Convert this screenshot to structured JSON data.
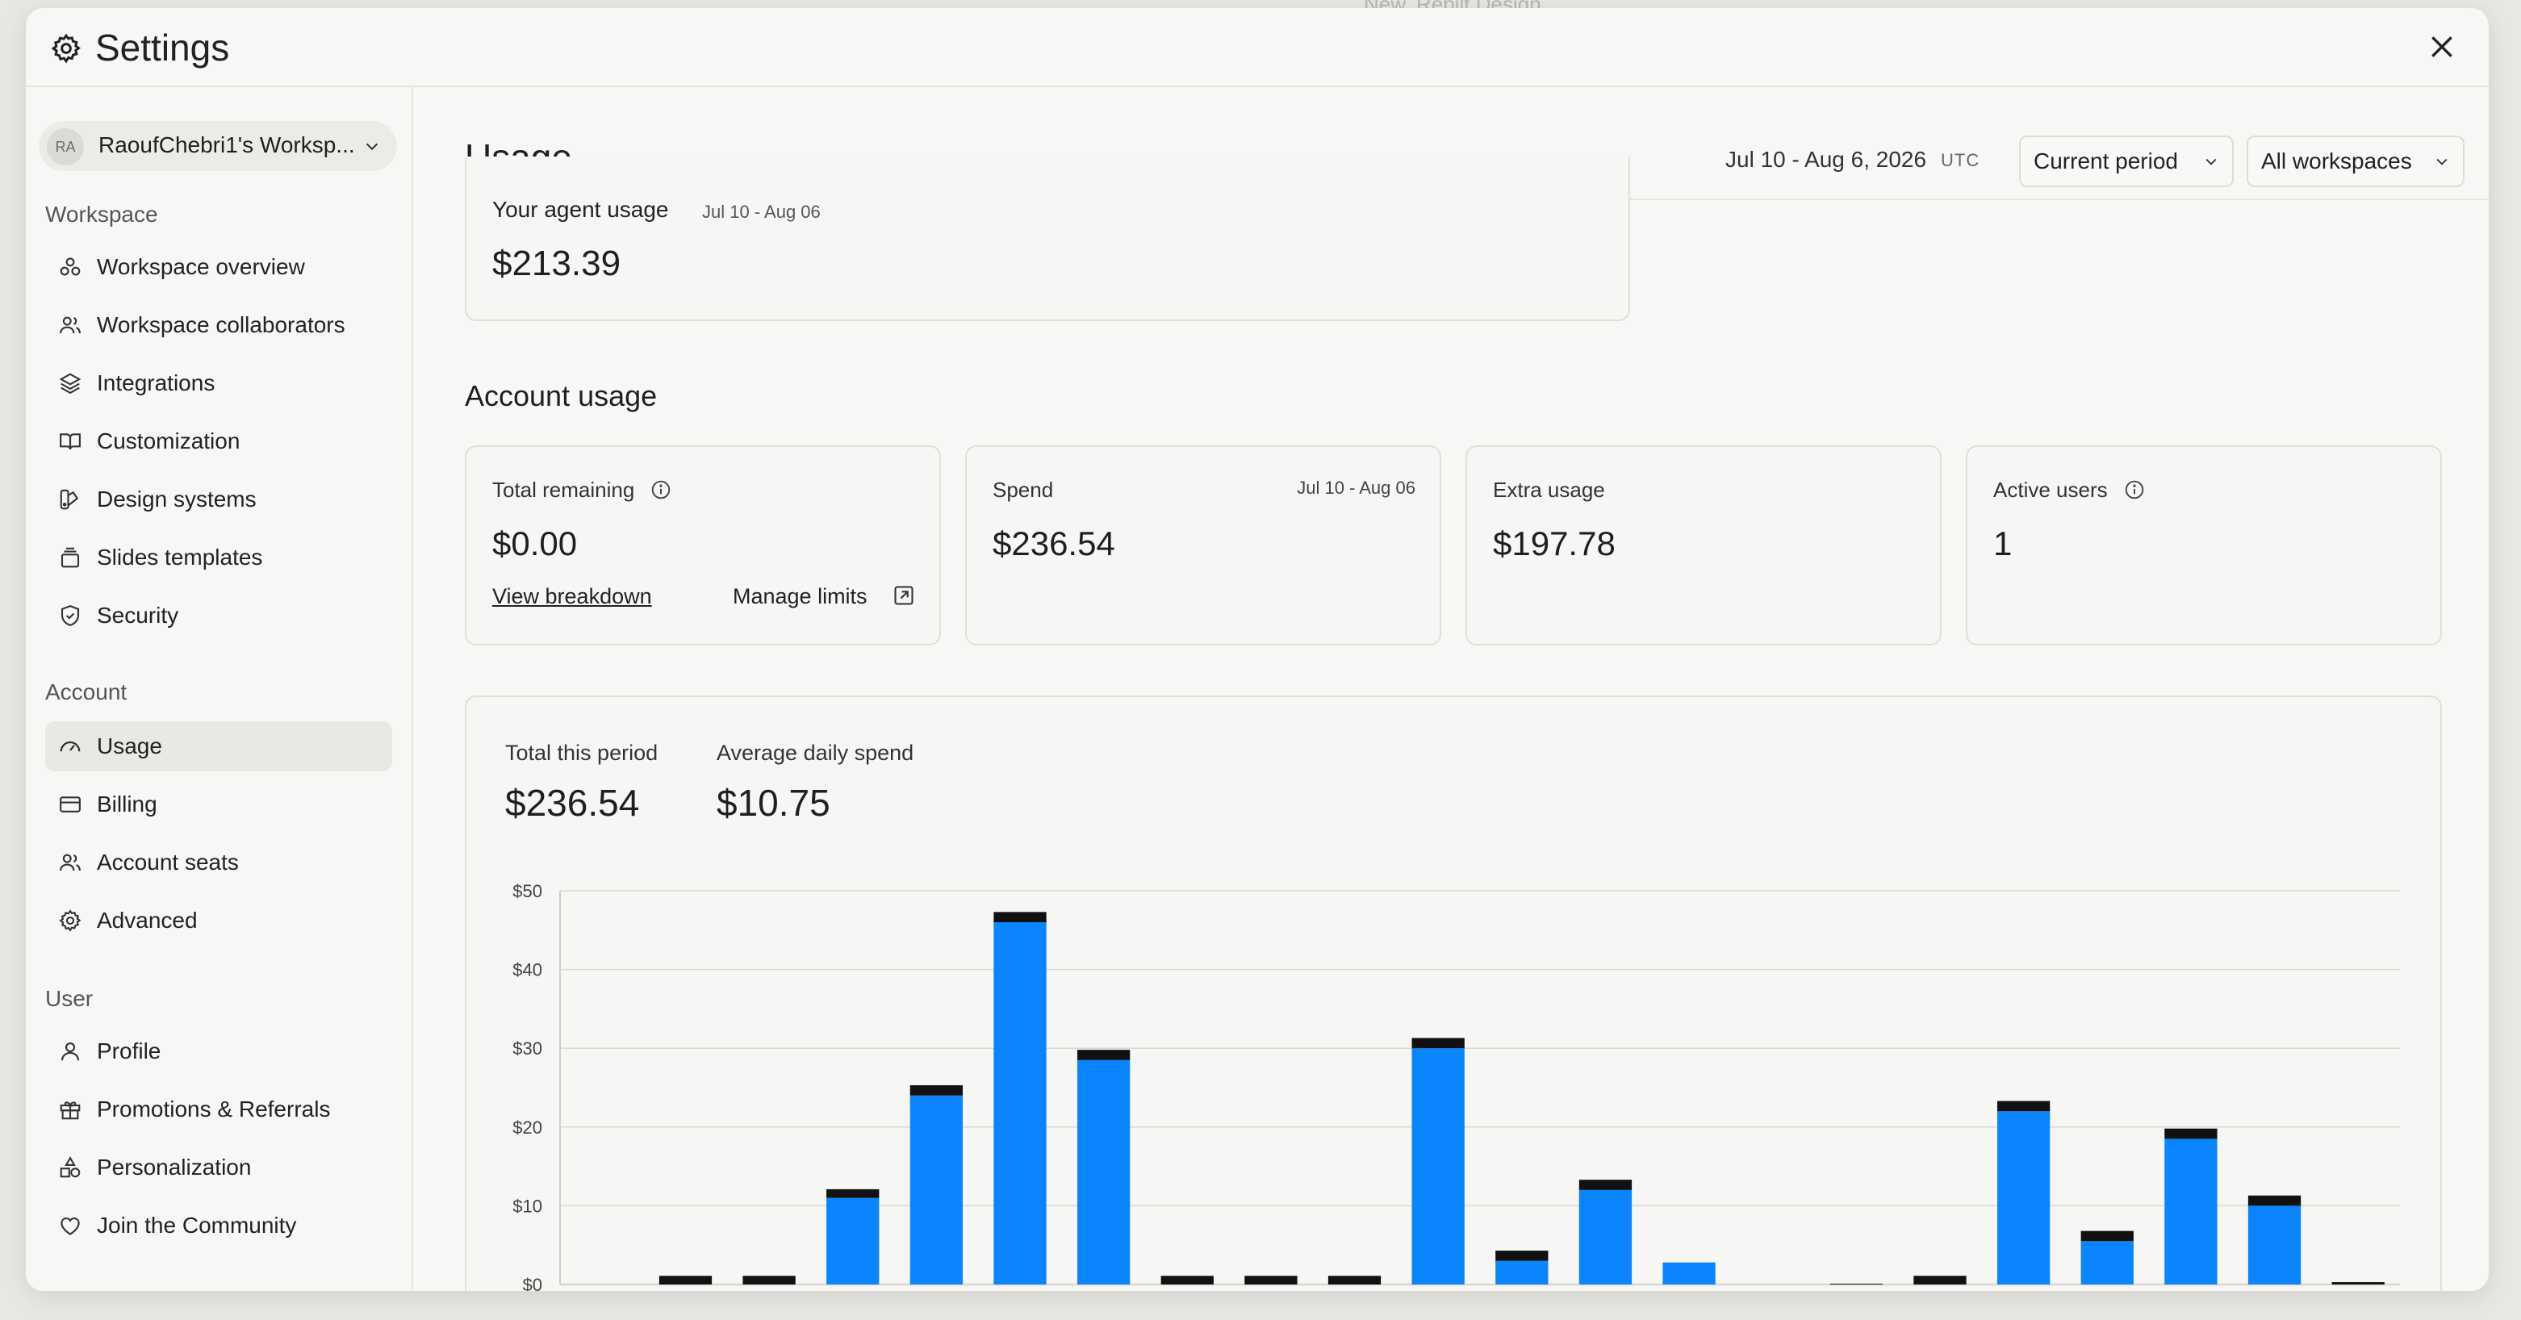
{
  "header": {
    "title": "Settings"
  },
  "background": {
    "text_1": "New. Rebilt Design"
  },
  "sidebar": {
    "workspace_switcher": {
      "initials": "RA",
      "name": "RaoufChebri1's Worksp..."
    },
    "sections": [
      {
        "label": "Workspace",
        "items": [
          {
            "label": "Workspace overview",
            "icon": "workspace-overview-icon"
          },
          {
            "label": "Workspace collaborators",
            "icon": "users-icon"
          },
          {
            "label": "Integrations",
            "icon": "layers-icon"
          },
          {
            "label": "Customization",
            "icon": "book-icon"
          },
          {
            "label": "Design systems",
            "icon": "palette-icon"
          },
          {
            "label": "Slides templates",
            "icon": "slides-icon"
          },
          {
            "label": "Security",
            "icon": "shield-icon"
          }
        ]
      },
      {
        "label": "Account",
        "items": [
          {
            "label": "Usage",
            "icon": "gauge-icon",
            "active": true
          },
          {
            "label": "Billing",
            "icon": "credit-card-icon"
          },
          {
            "label": "Account seats",
            "icon": "users-icon"
          },
          {
            "label": "Advanced",
            "icon": "gear-icon"
          }
        ]
      },
      {
        "label": "User",
        "items": [
          {
            "label": "Profile",
            "icon": "user-icon"
          },
          {
            "label": "Promotions & Referrals",
            "icon": "gift-icon"
          },
          {
            "label": "Personalization",
            "icon": "shapes-icon"
          },
          {
            "label": "Join the Community",
            "icon": "heart-icon"
          }
        ]
      }
    ]
  },
  "main": {
    "title": "Usage",
    "date_range": "Jul 10 - Aug 6, 2026",
    "timezone": "UTC",
    "period_select": "Current period",
    "workspace_select": "All workspaces",
    "agent_usage": {
      "title": "Your agent usage",
      "date": "Jul 10 - Aug 06",
      "value": "$213.39"
    },
    "account_usage_title": "Account usage",
    "cards": {
      "total_remaining": {
        "label": "Total remaining",
        "value": "$0.00",
        "link_breakdown": "View breakdown",
        "link_limits": "Manage limits"
      },
      "spend": {
        "label": "Spend",
        "date": "Jul 10 - Aug 06",
        "value": "$236.54"
      },
      "extra_usage": {
        "label": "Extra usage",
        "value": "$197.78"
      },
      "active_users": {
        "label": "Active users",
        "value": "1"
      }
    },
    "stats": {
      "total_label": "Total this period",
      "total_value": "$236.54",
      "avg_label": "Average daily spend",
      "avg_value": "$10.75"
    }
  },
  "colors": {
    "accent_blue": "#0a84ff",
    "bar_cap": "#111111",
    "grid": "#d9d8d4"
  },
  "chart_data": {
    "type": "bar",
    "stacked": true,
    "ylim": [
      0,
      50
    ],
    "y_ticks": [
      "$0",
      "$10",
      "$20",
      "$30",
      "$40",
      "$50"
    ],
    "grid": true,
    "series": [
      {
        "values": [
          0,
          0,
          0,
          11,
          24,
          46,
          28.5,
          0,
          0,
          0,
          30,
          3,
          12,
          2.8,
          0,
          0,
          0,
          22,
          5.5,
          18.5,
          10,
          0
        ]
      },
      {
        "values": [
          0,
          1.1,
          1.1,
          1.1,
          1.3,
          1.3,
          1.3,
          1.1,
          1.1,
          1.1,
          1.3,
          1.3,
          1.3,
          0,
          0,
          0.1,
          1.1,
          1.3,
          1.3,
          1.3,
          1.3,
          0.3
        ]
      }
    ]
  }
}
